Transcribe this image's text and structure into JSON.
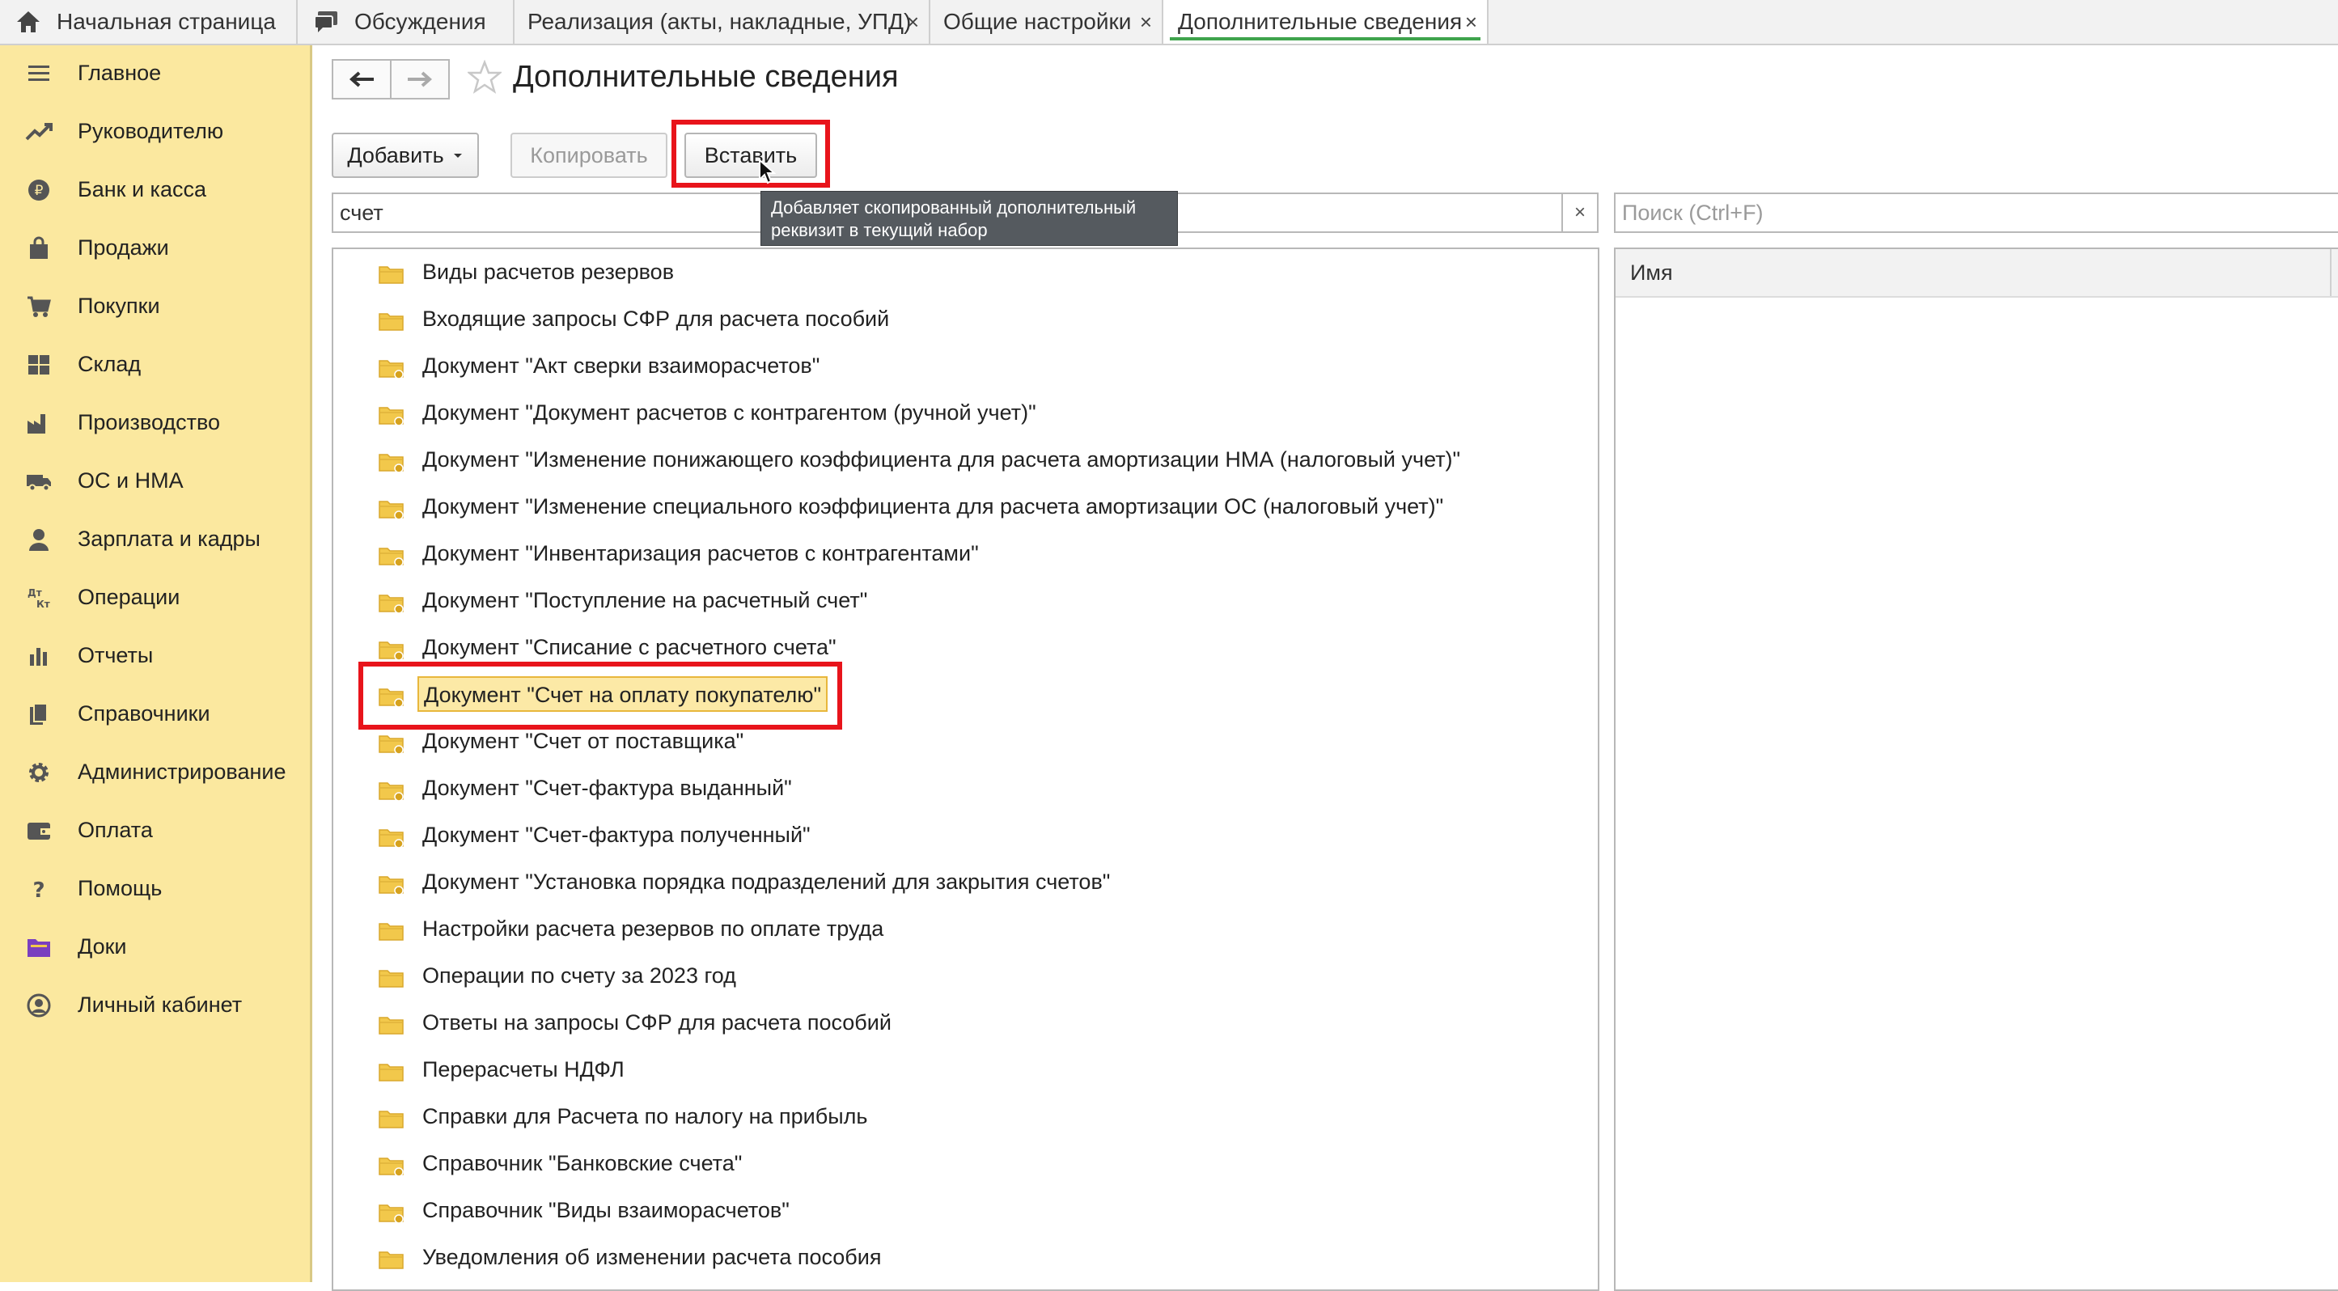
{
  "tabs": [
    {
      "label": "Начальная страница",
      "icon": "home-icon"
    },
    {
      "label": "Обсуждения",
      "icon": "chat-icon"
    },
    {
      "label": "Реализация (акты, накладные, УПД)",
      "closable": true
    },
    {
      "label": "Общие настройки",
      "closable": true
    },
    {
      "label": "Дополнительные сведения",
      "closable": true,
      "active": true
    }
  ],
  "sidebar": {
    "items": [
      {
        "label": "Главное",
        "icon": "menu-lines-icon"
      },
      {
        "label": "Руководителю",
        "icon": "trend-up-icon"
      },
      {
        "label": "Банк и касса",
        "icon": "ruble-coin-icon"
      },
      {
        "label": "Продажи",
        "icon": "shopping-bag-icon"
      },
      {
        "label": "Покупки",
        "icon": "cart-icon"
      },
      {
        "label": "Склад",
        "icon": "warehouse-grid-icon"
      },
      {
        "label": "Производство",
        "icon": "factory-icon"
      },
      {
        "label": "ОС и НМА",
        "icon": "truck-icon"
      },
      {
        "label": "Зарплата и кадры",
        "icon": "person-icon"
      },
      {
        "label": "Операции",
        "icon": "dt-kt-icon"
      },
      {
        "label": "Отчеты",
        "icon": "bar-chart-icon"
      },
      {
        "label": "Справочники",
        "icon": "books-icon"
      },
      {
        "label": "Администрирование",
        "icon": "gear-icon"
      },
      {
        "label": "Оплата",
        "icon": "wallet-icon"
      },
      {
        "label": "Помощь",
        "icon": "question-icon"
      },
      {
        "label": "Доки",
        "icon": "docs-folder-icon"
      },
      {
        "label": "Личный кабинет",
        "icon": "account-circle-icon"
      }
    ]
  },
  "form": {
    "title": "Дополнительные сведения",
    "buttons": {
      "add": "Добавить",
      "copy": "Копировать",
      "paste": "Вставить"
    },
    "filter_value": "счет",
    "search_placeholder": "Поиск (Ctrl+F)",
    "clear_symbol": "×",
    "tooltip": {
      "line1": "Добавляет скопированный дополнительный",
      "line2": "реквизит в текущий набор"
    },
    "right_column_header": "Имя"
  },
  "list": {
    "items": [
      {
        "label": "Виды расчетов резервов",
        "icon": "folder-icon"
      },
      {
        "label": "Входящие запросы СФР для расчета пособий",
        "icon": "folder-icon"
      },
      {
        "label": "Документ \"Акт сверки взаиморасчетов\"",
        "icon": "folder-doc-icon"
      },
      {
        "label": "Документ \"Документ расчетов с контрагентом (ручной учет)\"",
        "icon": "folder-doc-icon"
      },
      {
        "label": "Документ \"Изменение понижающего коэффициента для расчета амортизации НМА (налоговый учет)\"",
        "icon": "folder-doc-icon"
      },
      {
        "label": "Документ \"Изменение специального коэффициента для расчета амортизации ОС (налоговый учет)\"",
        "icon": "folder-doc-icon"
      },
      {
        "label": "Документ \"Инвентаризация расчетов с контрагентами\"",
        "icon": "folder-doc-icon"
      },
      {
        "label": "Документ \"Поступление на расчетный счет\"",
        "icon": "folder-doc-icon"
      },
      {
        "label": "Документ \"Списание с расчетного счета\"",
        "icon": "folder-doc-icon"
      },
      {
        "label": "Документ \"Счет на оплату покупателю\"",
        "icon": "folder-doc-icon",
        "selected": true
      },
      {
        "label": "Документ \"Счет от поставщика\"",
        "icon": "folder-doc-icon"
      },
      {
        "label": "Документ \"Счет-фактура выданный\"",
        "icon": "folder-doc-icon"
      },
      {
        "label": "Документ \"Счет-фактура полученный\"",
        "icon": "folder-doc-icon"
      },
      {
        "label": "Документ \"Установка порядка подразделений для закрытия счетов\"",
        "icon": "folder-doc-icon"
      },
      {
        "label": "Настройки расчета резервов по оплате труда",
        "icon": "folder-icon"
      },
      {
        "label": "Операции по счету за 2023 год",
        "icon": "folder-icon"
      },
      {
        "label": "Ответы на запросы СФР для расчета пособий",
        "icon": "folder-icon"
      },
      {
        "label": "Перерасчеты НДФЛ",
        "icon": "folder-icon"
      },
      {
        "label": "Справки для Расчета по налогу на прибыль",
        "icon": "folder-icon"
      },
      {
        "label": "Справочник \"Банковские счета\"",
        "icon": "folder-doc-icon"
      },
      {
        "label": "Справочник \"Виды взаиморасчетов\"",
        "icon": "folder-doc-icon"
      },
      {
        "label": "Уведомления об изменении расчета пособия",
        "icon": "folder-icon"
      }
    ]
  },
  "colors": {
    "sidebar_bg": "#fbe89f",
    "highlight_red": "#e8141b",
    "active_tab_underline": "#3fa34d",
    "folder": "#f2c84b",
    "selected_row_bg": "#fce9a6"
  }
}
